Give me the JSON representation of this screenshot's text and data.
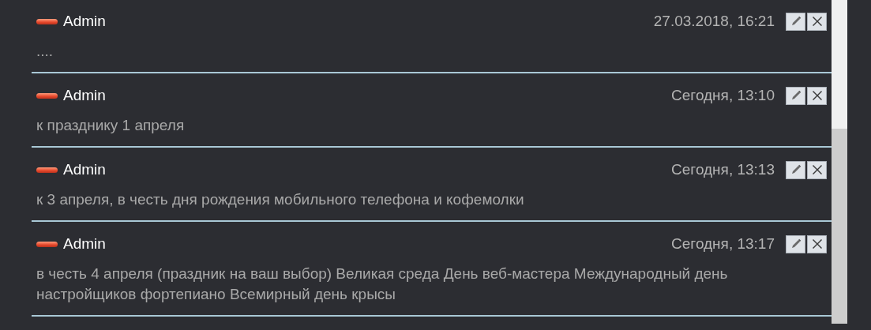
{
  "comments": [
    {
      "author": "Admin",
      "date": "27.03.2018, 16:21",
      "text": "...."
    },
    {
      "author": "Admin",
      "date": "Сегодня, 13:10",
      "text": "к празднику 1 апреля"
    },
    {
      "author": "Admin",
      "date": "Сегодня, 13:13",
      "text": "к 3 апреля, в честь дня рождения мобильного телефона и кофемолки"
    },
    {
      "author": "Admin",
      "date": "Сегодня, 13:17",
      "text": "в честь 4 апреля (праздник на ваш выбор) Великая среда День веб-мастера Международный день настройщиков фортепиано Всемирный день крысы"
    }
  ]
}
